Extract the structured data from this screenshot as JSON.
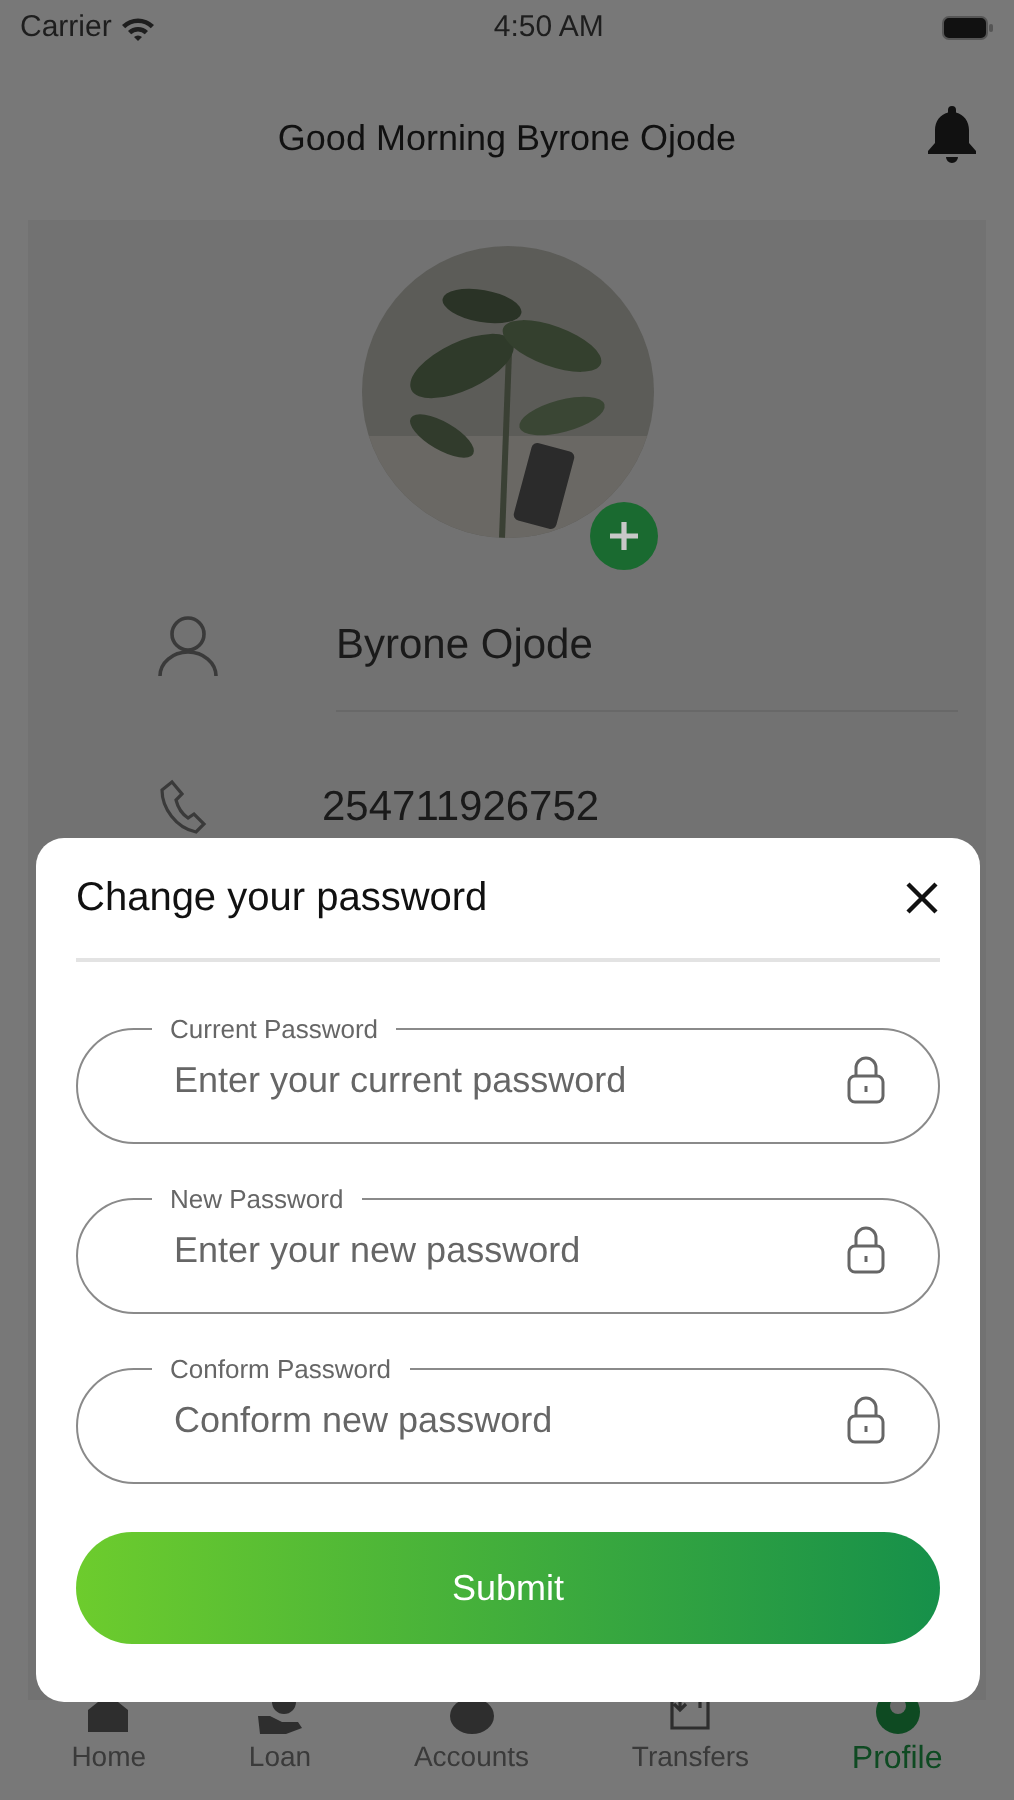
{
  "status_bar": {
    "carrier": "Carrier",
    "time": "4:50 AM"
  },
  "header": {
    "title": "Good Morning Byrone Ojode"
  },
  "profile": {
    "name": "Byrone Ojode",
    "phone": "254711926752"
  },
  "modal": {
    "title": "Change your password",
    "fields": [
      {
        "label": "Current Password",
        "placeholder": "Enter your current password"
      },
      {
        "label": "New Password",
        "placeholder": "Enter your new password"
      },
      {
        "label": "Conform Password",
        "placeholder": "Conform new password"
      }
    ],
    "submit": "Submit"
  },
  "nav": [
    {
      "kind": "home",
      "label": "Home",
      "selected": false
    },
    {
      "kind": "loan",
      "label": "Loan",
      "selected": false
    },
    {
      "kind": "accounts",
      "label": "Accounts",
      "selected": false
    },
    {
      "kind": "transfers",
      "label": "Transfers",
      "selected": false
    },
    {
      "kind": "profile",
      "label": "Profile",
      "selected": true
    }
  ]
}
